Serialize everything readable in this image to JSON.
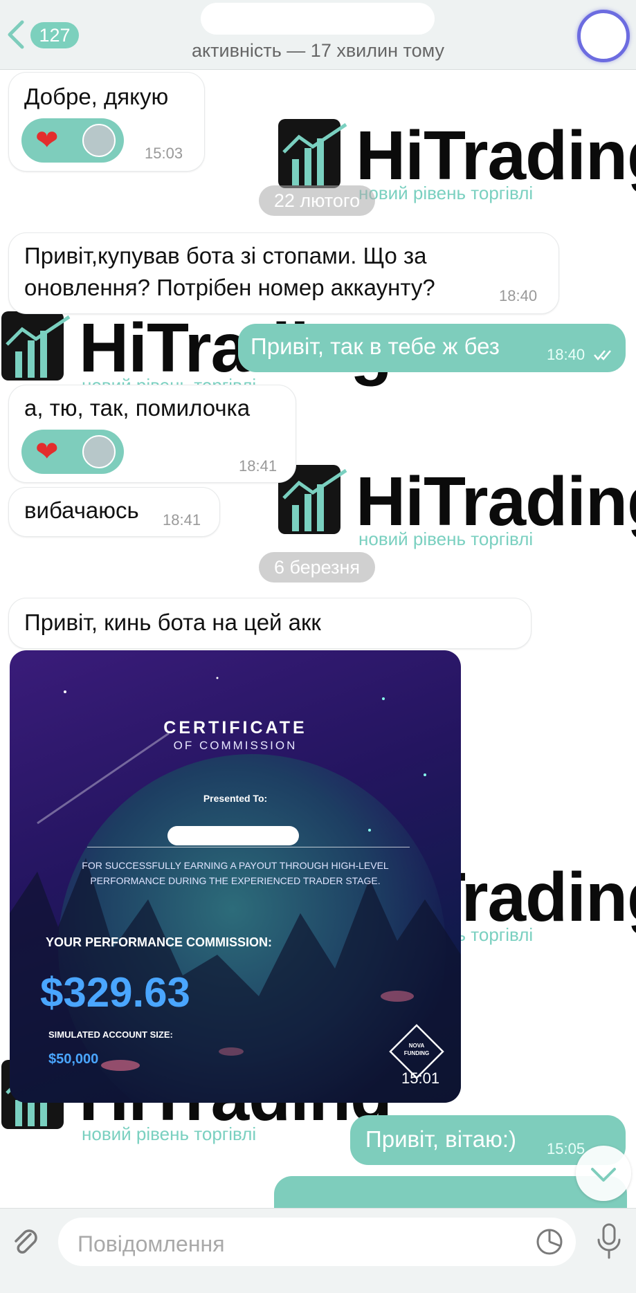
{
  "header": {
    "unread_count": "127",
    "status": "активність — 17 хвилин тому"
  },
  "watermark": {
    "brand": "HiTrading",
    "tagline": "новий рівень торгівлі"
  },
  "messages": {
    "m1": {
      "text": "Добре, дякую",
      "time": "15:03",
      "reaction": "❤"
    },
    "date1": "22 лютого",
    "m2": {
      "line1": "Привіт,купував бота зі стопами. Що за",
      "line2": "оновлення? Потрібен номер аккаунту?",
      "time": "18:40"
    },
    "m3": {
      "text": "Привіт, так в тебе ж без",
      "time": "18:40"
    },
    "m4": {
      "text": "а, тю, так, помилочка",
      "time": "18:41",
      "reaction": "❤"
    },
    "m5": {
      "text": "вибачаюсь",
      "time": "18:41"
    },
    "date2": "6 березня",
    "m6": {
      "text": "Привіт, кинь бота на цей акк"
    },
    "certificate": {
      "title": "CERTIFICATE",
      "subtitle": "OF COMMISSION",
      "presented": "Presented To:",
      "body_line1": "FOR SUCCESSFULLY EARNING A PAYOUT THROUGH HIGH-LEVEL",
      "body_line2": "PERFORMANCE DURING THE EXPERIENCED TRADER STAGE.",
      "perf_label": "YOUR PERFORMANCE COMMISSION:",
      "amount": "$329.63",
      "size_label": "SIMULATED ACCOUNT SIZE:",
      "size": "$50,000",
      "logo_line1": "NOVA",
      "logo_line2": "FUNDING",
      "time": "15:01"
    },
    "m7": {
      "text": "Привіт, вітаю:)",
      "time": "15:05"
    }
  },
  "composer": {
    "placeholder": "Повідомлення"
  },
  "colors": {
    "accent": "#7ecdbc",
    "header_bg": "#eef2f2",
    "amount_blue": "#4aa6ff"
  },
  "icons": [
    "back-chevron-icon",
    "attach-icon",
    "sticker-icon",
    "microphone-icon",
    "chevron-down-icon",
    "double-check-icon"
  ]
}
